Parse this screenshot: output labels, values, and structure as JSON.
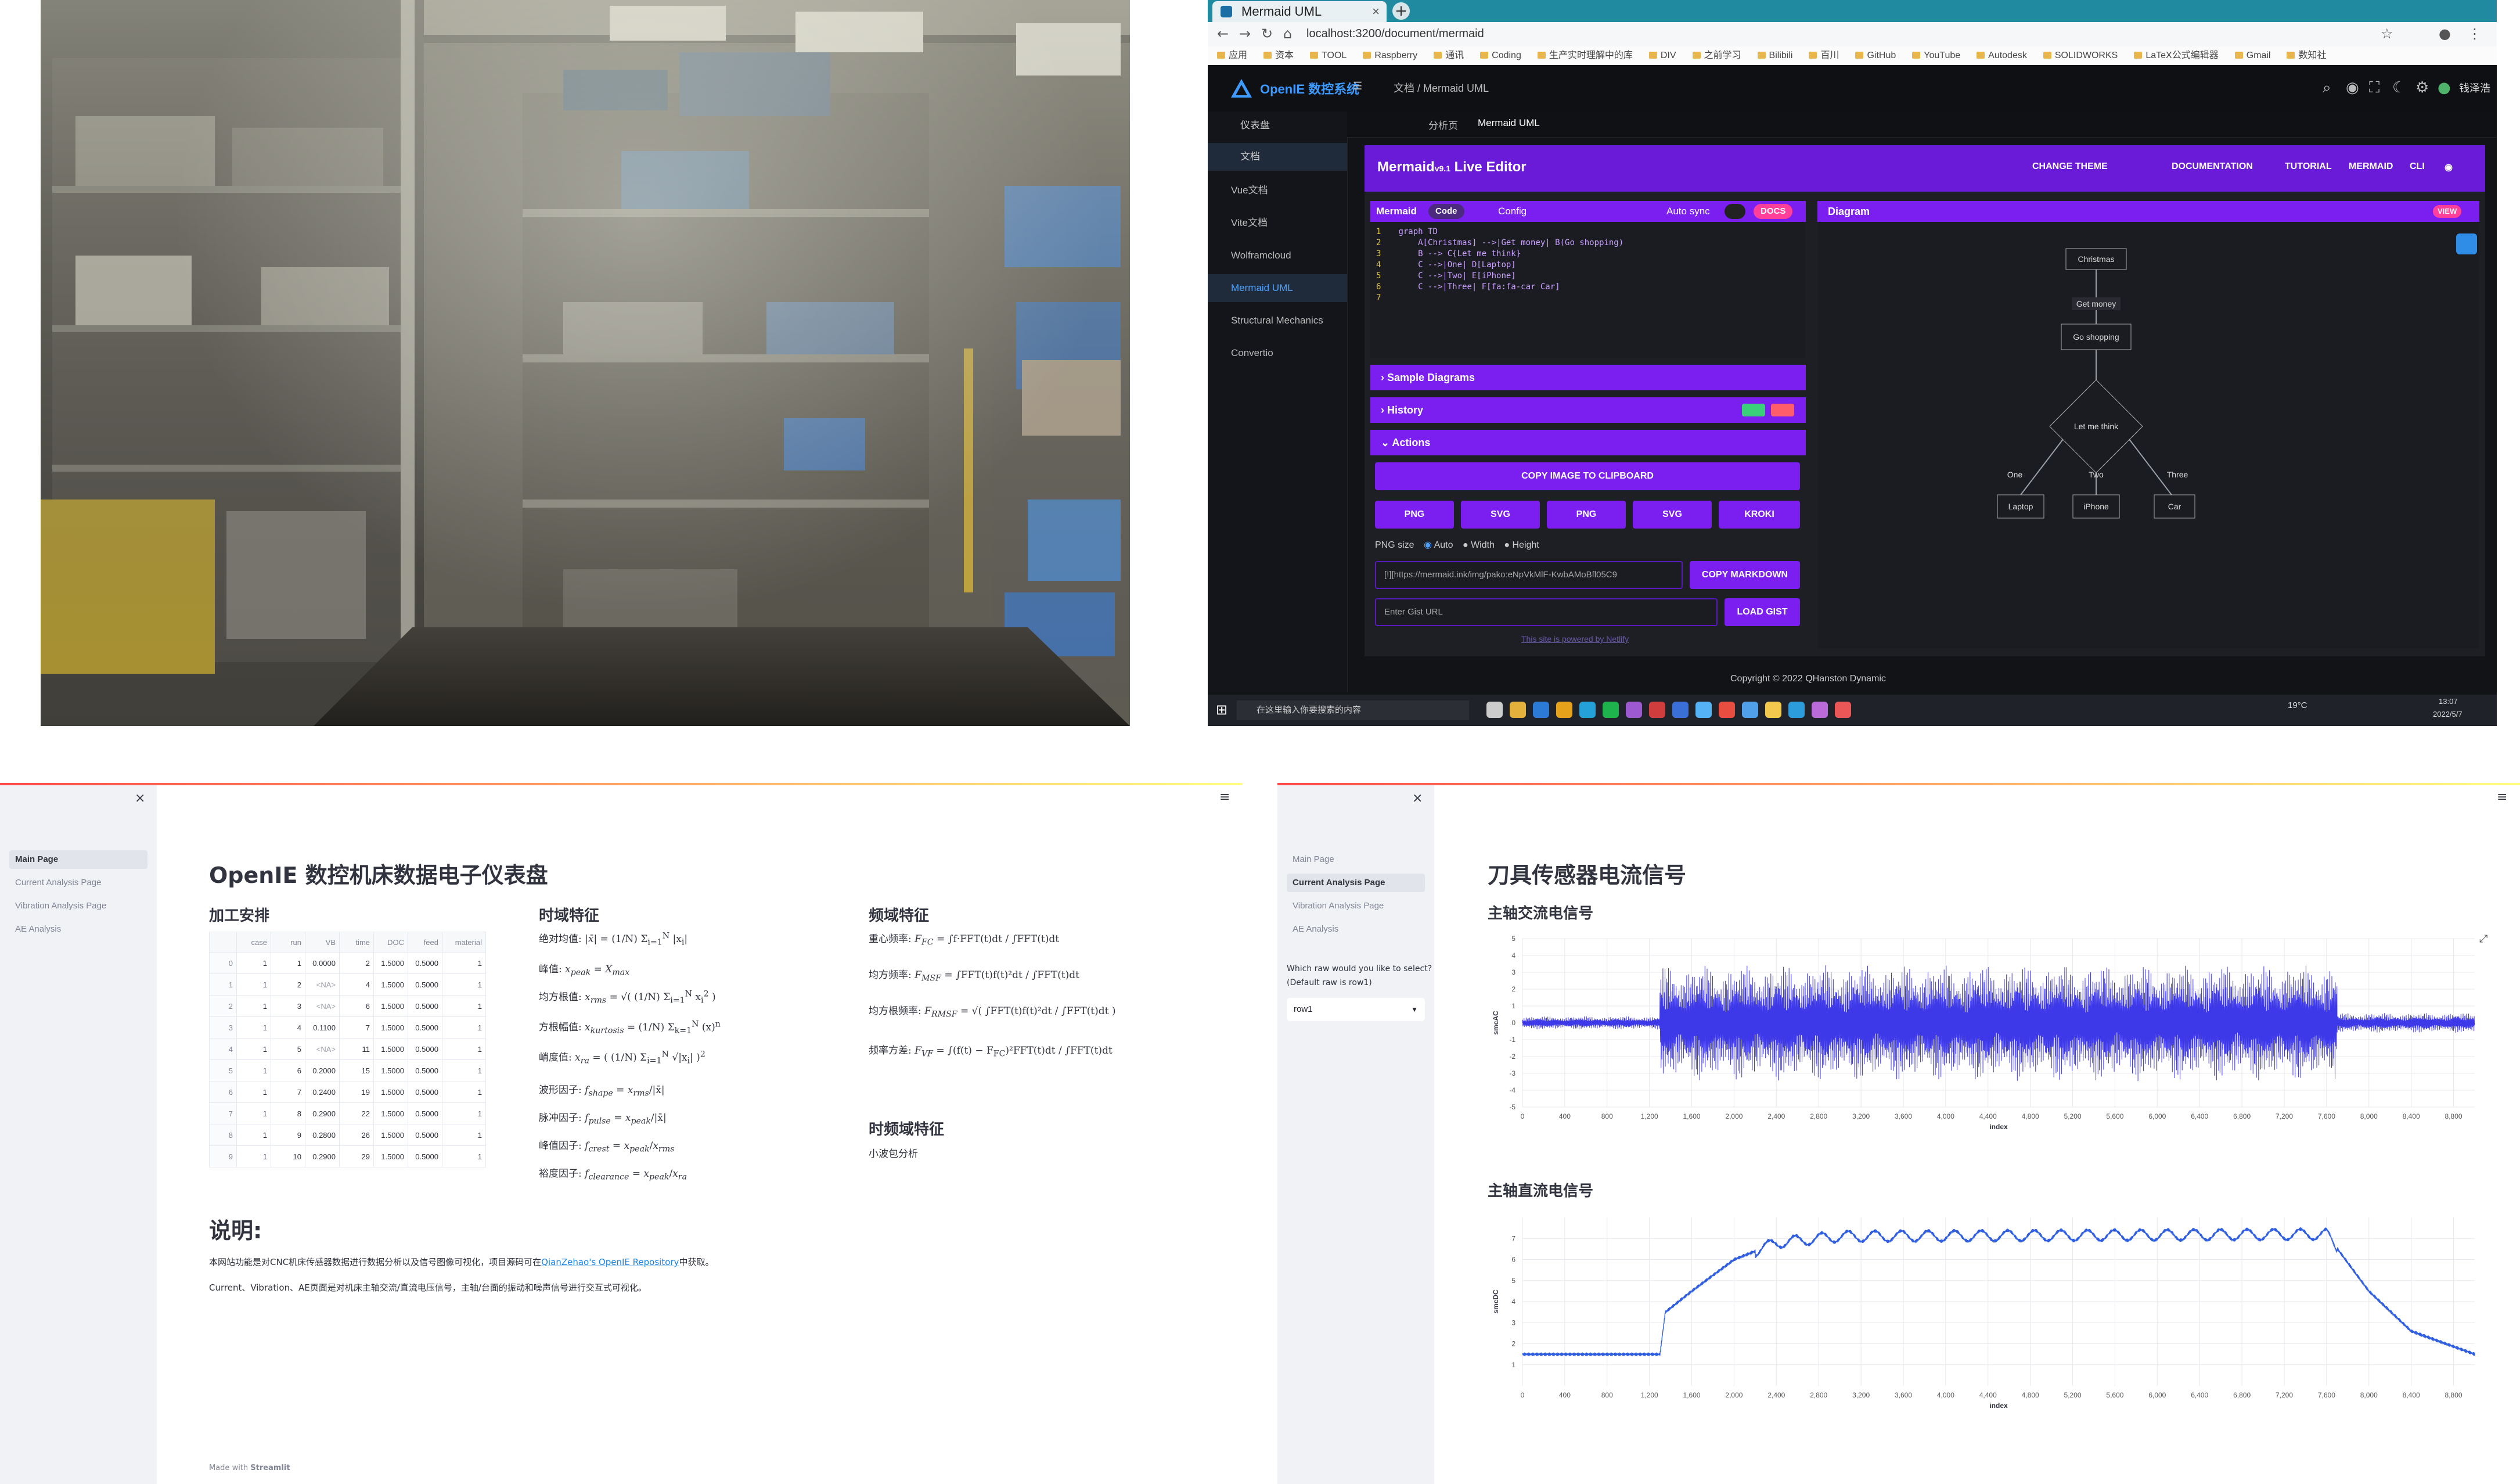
{
  "panel2": {
    "browser_tab": "Mermaid UML",
    "url": "localhost:3200/document/mermaid",
    "bookmarks": [
      "应用",
      "资本",
      "TOOL",
      "Raspberry",
      "通讯",
      "Coding",
      "生产实时理解中的库",
      "DIV",
      "之前学习",
      "Bilibili",
      "百川",
      "GitHub",
      "YouTube",
      "Autodesk",
      "SOLIDWORKS",
      "LaTeX公式编辑器",
      "Gmail",
      "数知社"
    ],
    "app_brand": "OpenIE 数控系统",
    "breadcrumb": "文档 / Mermaid UML",
    "user": "钱泽浩",
    "sidebar": [
      "仪表盘",
      "文档",
      "Vue文档",
      "Vite文档",
      "Wolframcloud",
      "Mermaid UML",
      "Structural Mechanics",
      "Convertio"
    ],
    "page_tabs": [
      "分析页",
      "Mermaid UML"
    ],
    "editor_title": "Mermaid",
    "editor_version": "v9.1",
    "editor_subtitle": "Live Editor",
    "top_links": [
      "CHANGE THEME",
      "DOCUMENTATION",
      "TUTORIAL",
      "MERMAID",
      "CLI"
    ],
    "code_title": "Mermaid",
    "code_tab": "Code",
    "config_tab": "Config",
    "auto_sync": "Auto sync",
    "docs_btn": "DOCS",
    "code_lines": [
      "graph TD",
      "    A[Christmas] -->|Get money| B(Go shopping)",
      "    B --> C{Let me think}",
      "    C -->|One| D[Laptop]",
      "    C -->|Two| E[iPhone]",
      "    C -->|Three| F[fa:fa-car Car]",
      ""
    ],
    "sections": {
      "samples": "Sample Diagrams",
      "history": "History",
      "actions": "Actions"
    },
    "copy_image": "COPY IMAGE TO CLIPBOARD",
    "export_buttons": [
      "PNG",
      "SVG",
      "PNG",
      "SVG",
      "KROKI"
    ],
    "png_size_label": "PNG size",
    "png_size_options": [
      "Auto",
      "Width",
      "Height"
    ],
    "link_value": "[!][https://mermaid.ink/img/pako:eNpVkMlF-KwbAMoBfl05C9",
    "copy_markdown": "COPY MARKDOWN",
    "gist_placeholder": "Enter Gist URL",
    "load_gist": "LOAD GIST",
    "netlify": "This site is powered by Netlify",
    "diagram_title": "Diagram",
    "view_btn": "VIEW",
    "diagram_nodes": {
      "a": "Christmas",
      "ab": "Get money",
      "b": "Go shopping",
      "c": "Let me think",
      "e1": "One",
      "e2": "Two",
      "e3": "Three",
      "d": "Laptop",
      "e": "iPhone",
      "f": "Car"
    },
    "copyright": "Copyright © 2022 QHanston Dynamic",
    "taskbar_search": "在这里输入你要搜索的内容",
    "tray_temp": "19°C",
    "tray_time": "13:07",
    "tray_date": "2022/5/7"
  },
  "panel3": {
    "nav": [
      "Main Page",
      "Current Analysis Page",
      "Vibration Analysis Page",
      "AE Analysis"
    ],
    "title": "OpenIE 数控机床数据电子仪表盘",
    "table_heading": "加工安排",
    "table_columns": [
      "",
      "case",
      "run",
      "VB",
      "time",
      "DOC",
      "feed",
      "material"
    ],
    "table_rows": [
      [
        "0",
        "1",
        "1",
        "0.0000",
        "2",
        "1.5000",
        "0.5000",
        "1"
      ],
      [
        "1",
        "1",
        "2",
        "<NA>",
        "4",
        "1.5000",
        "0.5000",
        "1"
      ],
      [
        "2",
        "1",
        "3",
        "<NA>",
        "6",
        "1.5000",
        "0.5000",
        "1"
      ],
      [
        "3",
        "1",
        "4",
        "0.1100",
        "7",
        "1.5000",
        "0.5000",
        "1"
      ],
      [
        "4",
        "1",
        "5",
        "<NA>",
        "11",
        "1.5000",
        "0.5000",
        "1"
      ],
      [
        "5",
        "1",
        "6",
        "0.2000",
        "15",
        "1.5000",
        "0.5000",
        "1"
      ],
      [
        "6",
        "1",
        "7",
        "0.2400",
        "19",
        "1.5000",
        "0.5000",
        "1"
      ],
      [
        "7",
        "1",
        "8",
        "0.2900",
        "22",
        "1.5000",
        "0.5000",
        "1"
      ],
      [
        "8",
        "1",
        "9",
        "0.2800",
        "26",
        "1.5000",
        "0.5000",
        "1"
      ],
      [
        "9",
        "1",
        "10",
        "0.2900",
        "29",
        "1.5000",
        "0.5000",
        "1"
      ]
    ],
    "time_heading": "时域特征",
    "time_features": [
      "绝对均值:",
      "峰值:",
      "均方根值:",
      "方根幅值:",
      "峭度值:",
      "波形因子:",
      "脉冲因子:",
      "峰值因子:",
      "裕度因子:"
    ],
    "freq_heading": "频域特征",
    "freq_features": [
      "重心频率:",
      "均方频率:",
      "均方根频率:",
      "频率方差:"
    ],
    "tf_heading": "时频域特征",
    "tf_item": "小波包分析",
    "note_heading": "说明:",
    "note_p1_a": "本网站功能是对CNC机床传感器数据进行数据分析以及信号图像可视化，项目源码可在",
    "note_link": "QianZehao's OpenIE Repository",
    "note_p1_b": "中获取。",
    "note_p2": "Current、Vibration、AE页面是对机床主轴交流/直流电压信号，主轴/台面的振动和噪声信号进行交互式可视化。",
    "footer_made": "Made with",
    "footer_brand": "Streamlit"
  },
  "panel4": {
    "nav": [
      "Main Page",
      "Current Analysis Page",
      "Vibration Analysis Page",
      "AE Analysis"
    ],
    "select_label_1": "Which raw would you like to select?",
    "select_label_2": "(Default raw is row1)",
    "select_value": "row1",
    "title": "刀具传感器电流信号",
    "ac_heading": "主轴交流电信号",
    "dc_heading": "主轴直流电信号"
  },
  "chart_data": [
    {
      "type": "line",
      "title": "主轴交流电信号",
      "xlabel": "index",
      "ylabel": "smcAC",
      "xlim": [
        0,
        9000
      ],
      "ylim": [
        -5,
        5
      ],
      "x_ticks": [
        0,
        400,
        800,
        1200,
        1600,
        2000,
        2400,
        2800,
        3200,
        3600,
        4000,
        4400,
        4800,
        5200,
        5600,
        6000,
        6400,
        6800,
        7200,
        7600,
        8000,
        8400,
        8800
      ],
      "y_ticks": [
        -5,
        -4,
        -3,
        -2,
        -1,
        0,
        1,
        2,
        3,
        4,
        5
      ],
      "segments": [
        {
          "x_start": 0,
          "x_end": 1300,
          "amplitude": 0.4
        },
        {
          "x_start": 1300,
          "x_end": 7700,
          "amplitude": 3.5
        },
        {
          "x_start": 7700,
          "x_end": 9000,
          "amplitude": 0.6
        }
      ],
      "color": "#3d38e8",
      "grid": true
    },
    {
      "type": "line",
      "title": "主轴直流电信号",
      "xlabel": "index",
      "ylabel": "smcDC",
      "xlim": [
        0,
        9000
      ],
      "ylim": [
        0,
        8
      ],
      "x_ticks": [
        0,
        400,
        800,
        1200,
        1600,
        2000,
        2400,
        2800,
        3200,
        3600,
        4000,
        4400,
        4800,
        5200,
        5600,
        6000,
        6400,
        6800,
        7200,
        7600,
        8000,
        8400,
        8800
      ],
      "y_ticks": [
        1,
        2,
        3,
        4,
        5,
        6,
        7
      ],
      "key_points": [
        [
          0,
          1.5
        ],
        [
          1300,
          1.5
        ],
        [
          1350,
          3.5
        ],
        [
          1600,
          4.5
        ],
        [
          2000,
          6.0
        ],
        [
          2400,
          6.8
        ],
        [
          3000,
          7.1
        ],
        [
          7600,
          7.2
        ],
        [
          8000,
          4.5
        ],
        [
          8400,
          2.6
        ],
        [
          9000,
          1.5
        ]
      ],
      "color": "#2f5fe0",
      "grid": true
    }
  ]
}
